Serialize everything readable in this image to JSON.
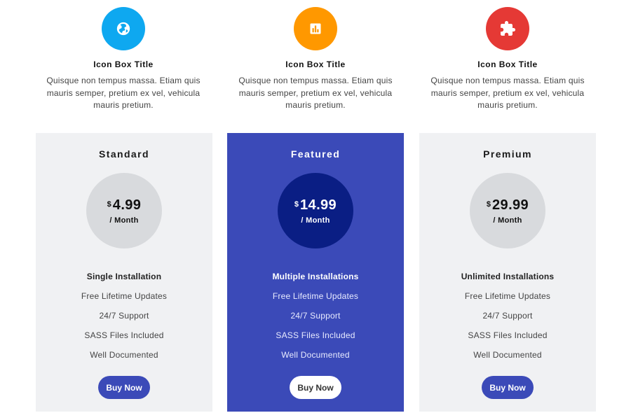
{
  "icon_boxes": [
    {
      "icon": "globe-icon",
      "color": "#0ea8f0",
      "title": "Icon Box Title",
      "description": "Quisque non tempus massa. Etiam quis mauris semper, pretium ex vel, vehicula mauris pretium."
    },
    {
      "icon": "bar-chart-icon",
      "color": "#ff9800",
      "title": "Icon Box Title",
      "description": "Quisque non tempus massa. Etiam quis mauris semper, pretium ex vel, vehicula mauris pretium."
    },
    {
      "icon": "puzzle-icon",
      "color": "#e53935",
      "title": "Icon Box Title",
      "description": "Quisque non tempus massa. Etiam quis mauris semper, pretium ex vel, vehicula mauris pretium."
    }
  ],
  "plans": [
    {
      "name": "Standard",
      "currency": "$",
      "price": "4.99",
      "period": "/ Month",
      "features": [
        "Single Installation",
        "Free Lifetime Updates",
        "24/7 Support",
        "SASS Files Included",
        "Well Documented"
      ],
      "button_label": "Buy Now"
    },
    {
      "name": "Featured",
      "currency": "$",
      "price": "14.99",
      "period": "/ Month",
      "features": [
        "Multiple Installations",
        "Free Lifetime Updates",
        "24/7 Support",
        "SASS Files Included",
        "Well Documented"
      ],
      "button_label": "Buy Now"
    },
    {
      "name": "Premium",
      "currency": "$",
      "price": "29.99",
      "period": "/ Month",
      "features": [
        "Unlimited Installations",
        "Free Lifetime Updates",
        "24/7 Support",
        "SASS Files Included",
        "Well Documented"
      ],
      "button_label": "Buy Now"
    }
  ],
  "colors": {
    "accent": "#3b4ab8",
    "featured_circle": "#0a1e84",
    "card_bg": "#f0f1f3",
    "price_circle": "#d8dadd"
  }
}
